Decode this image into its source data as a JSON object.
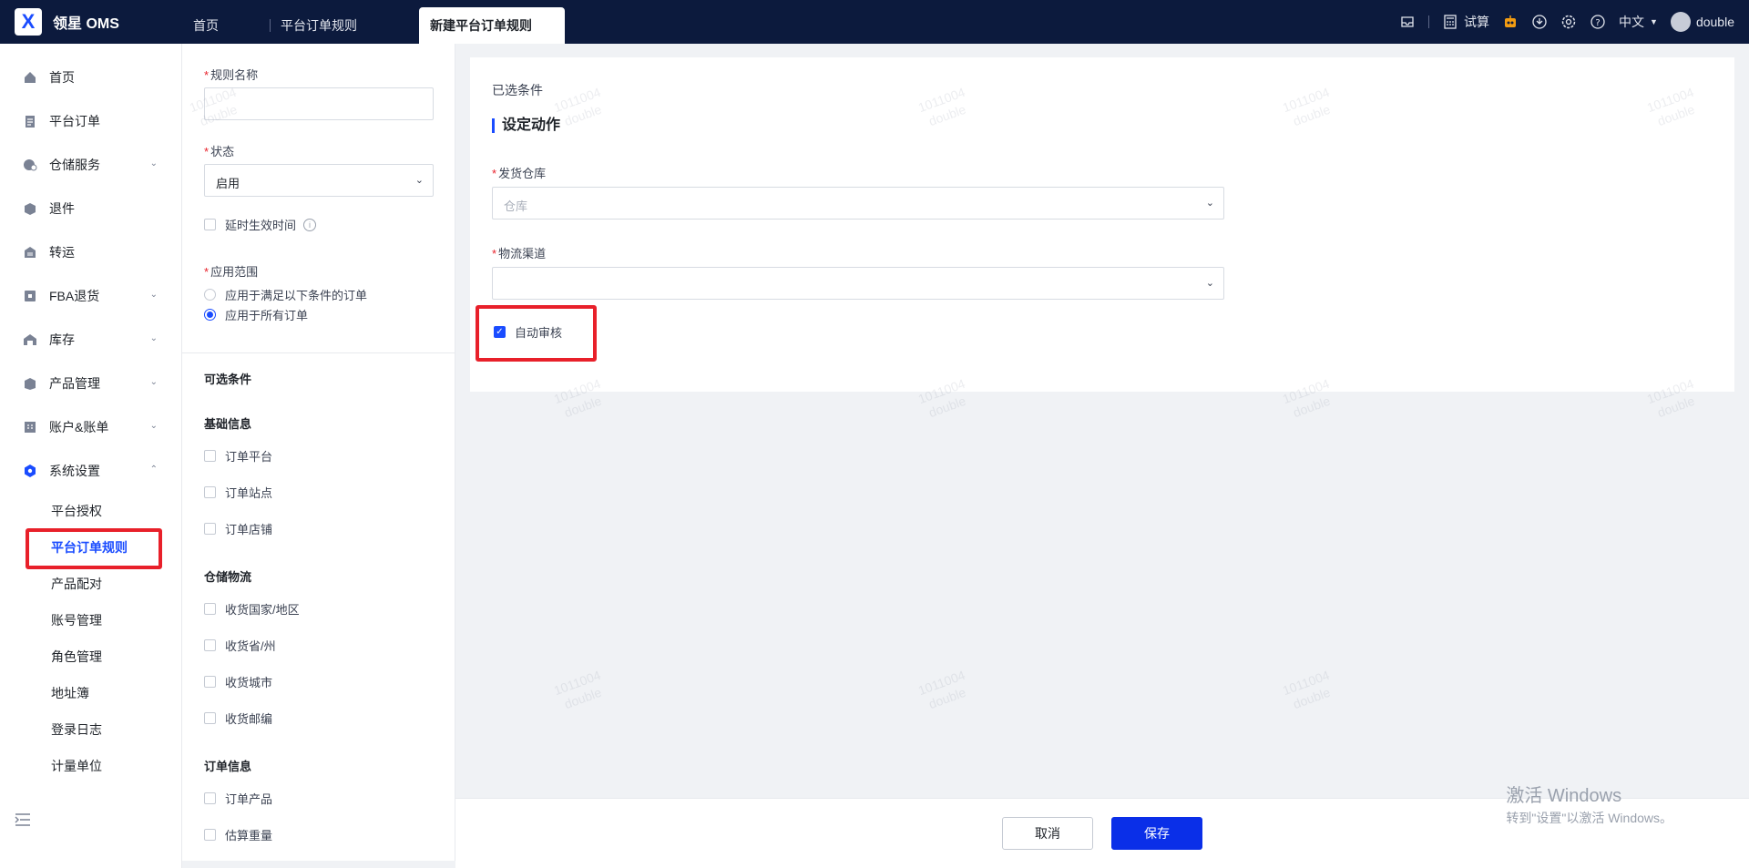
{
  "app": {
    "logo_glyph": "X",
    "name": "领星 OMS"
  },
  "tabs": [
    {
      "label": "首页"
    },
    {
      "label": "平台订单规则"
    },
    {
      "label": "新建平台订单规则"
    }
  ],
  "topbar": {
    "calc_label": "试算",
    "lang_label": "中文",
    "user_name": "double"
  },
  "sidebar": {
    "items": [
      {
        "label": "首页",
        "icon": "home-icon"
      },
      {
        "label": "平台订单",
        "icon": "clipboard-icon"
      },
      {
        "label": "仓储服务",
        "icon": "warehouse-icon"
      },
      {
        "label": "退件",
        "icon": "return-icon"
      },
      {
        "label": "转运",
        "icon": "transfer-icon"
      },
      {
        "label": "FBA退货",
        "icon": "fba-icon"
      },
      {
        "label": "库存",
        "icon": "inventory-icon"
      },
      {
        "label": "产品管理",
        "icon": "product-icon"
      },
      {
        "label": "账户&账单",
        "icon": "account-icon"
      },
      {
        "label": "系统设置",
        "icon": "settings-icon"
      }
    ],
    "sub_items": [
      {
        "label": "平台授权"
      },
      {
        "label": "平台订单规则"
      },
      {
        "label": "产品配对"
      },
      {
        "label": "账号管理"
      },
      {
        "label": "角色管理"
      },
      {
        "label": "地址簿"
      },
      {
        "label": "登录日志"
      },
      {
        "label": "计量单位"
      }
    ]
  },
  "config": {
    "rule_name_label": "规则名称",
    "rule_name_value": "",
    "status_label": "状态",
    "status_value": "启用",
    "delay_label": "延时生效时间",
    "scope_label": "应用范围",
    "scope_option_1": "应用于满足以下条件的订单",
    "scope_option_2": "应用于所有订单",
    "optional_title": "可选条件",
    "basic_title": "基础信息",
    "basic_items": [
      "订单平台",
      "订单站点",
      "订单店铺"
    ],
    "logistics_title": "仓储物流",
    "logistics_items": [
      "收货国家/地区",
      "收货省/州",
      "收货城市",
      "收货邮编"
    ],
    "order_title": "订单信息",
    "order_items": [
      "订单产品",
      "估算重量"
    ]
  },
  "main": {
    "selected_label": "已选条件",
    "action_title": "设定动作",
    "warehouse_label": "发货仓库",
    "warehouse_placeholder": "仓库",
    "channel_label": "物流渠道",
    "channel_value": "",
    "auto_review_label": "自动审核",
    "auto_review_checked": true
  },
  "footer": {
    "cancel_label": "取消",
    "save_label": "保存"
  },
  "windows": {
    "line1": "激活 Windows",
    "line2": "转到\"设置\"以激活 Windows。"
  },
  "watermark": {
    "line1": "1011004",
    "line2": "double"
  },
  "colors": {
    "topbar": "#0c1a3d",
    "accent": "#1a4cff",
    "highlight": "#e8202a"
  }
}
